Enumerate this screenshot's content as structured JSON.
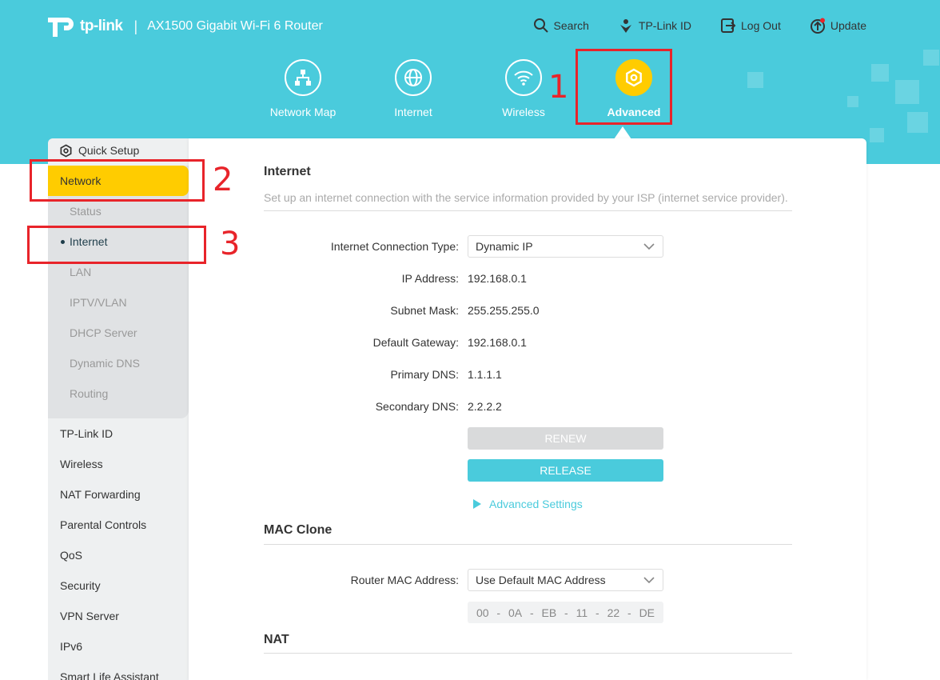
{
  "header": {
    "brand": "tp-link",
    "separator": "|",
    "model": "AX1500 Gigabit Wi-Fi 6 Router",
    "top_links": {
      "search": "Search",
      "tplink_id": "TP-Link ID",
      "logout": "Log Out",
      "update": "Update"
    },
    "nav": {
      "network_map": "Network Map",
      "internet": "Internet",
      "wireless": "Wireless",
      "advanced": "Advanced"
    }
  },
  "annotations": {
    "one": "1",
    "two": "2",
    "three": "3",
    "color": "#e8242a"
  },
  "sidebar": {
    "quick_setup": "Quick Setup",
    "network": "Network",
    "network_sub": {
      "status": "Status",
      "internet": "Internet",
      "lan": "LAN",
      "iptv": "IPTV/VLAN",
      "dhcp": "DHCP Server",
      "ddns": "Dynamic DNS",
      "routing": "Routing"
    },
    "items": {
      "tplink_id": "TP-Link ID",
      "wireless": "Wireless",
      "nat": "NAT Forwarding",
      "parental": "Parental Controls",
      "qos": "QoS",
      "security": "Security",
      "vpn": "VPN Server",
      "ipv6": "IPv6",
      "smart_life": "Smart Life Assistant"
    }
  },
  "internet": {
    "title": "Internet",
    "description": "Set up an internet connection with the service information provided by your ISP (internet service provider).",
    "connection_type_label": "Internet Connection Type:",
    "connection_type_value": "Dynamic IP",
    "ip_label": "IP Address:",
    "ip_value": "192.168.0.1",
    "subnet_label": "Subnet Mask:",
    "subnet_value": "255.255.255.0",
    "gateway_label": "Default Gateway:",
    "gateway_value": "192.168.0.1",
    "primary_dns_label": "Primary DNS:",
    "primary_dns_value": "1.1.1.1",
    "secondary_dns_label": "Secondary DNS:",
    "secondary_dns_value": "2.2.2.2",
    "renew": "RENEW",
    "release": "RELEASE",
    "advanced_settings": "Advanced Settings"
  },
  "mac_clone": {
    "title": "MAC Clone",
    "router_mac_label": "Router MAC Address:",
    "router_mac_value": "Use Default MAC Address",
    "mac_parts": [
      "00",
      "0A",
      "EB",
      "11",
      "22",
      "DE"
    ],
    "mac_sep": "-"
  },
  "nat": {
    "title": "NAT"
  },
  "colors": {
    "brand": "#4acbdc",
    "active": "#ffcc00"
  }
}
